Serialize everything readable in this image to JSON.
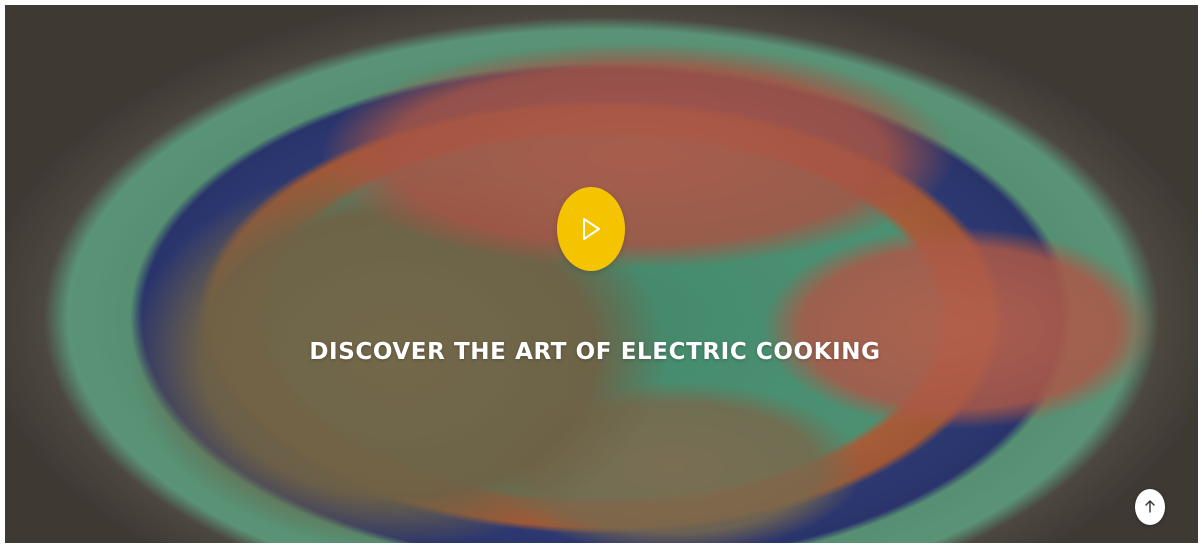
{
  "hero": {
    "title": "DISCOVER THE ART OF ELECTRIC COOKING",
    "background_image": "food-plate-photo",
    "play_icon": "play-icon",
    "back_to_top_icon": "arrow-up-icon"
  },
  "colors": {
    "accent": "#f5c400",
    "text": "#ffffff",
    "back_to_top_bg": "#ffffff"
  }
}
